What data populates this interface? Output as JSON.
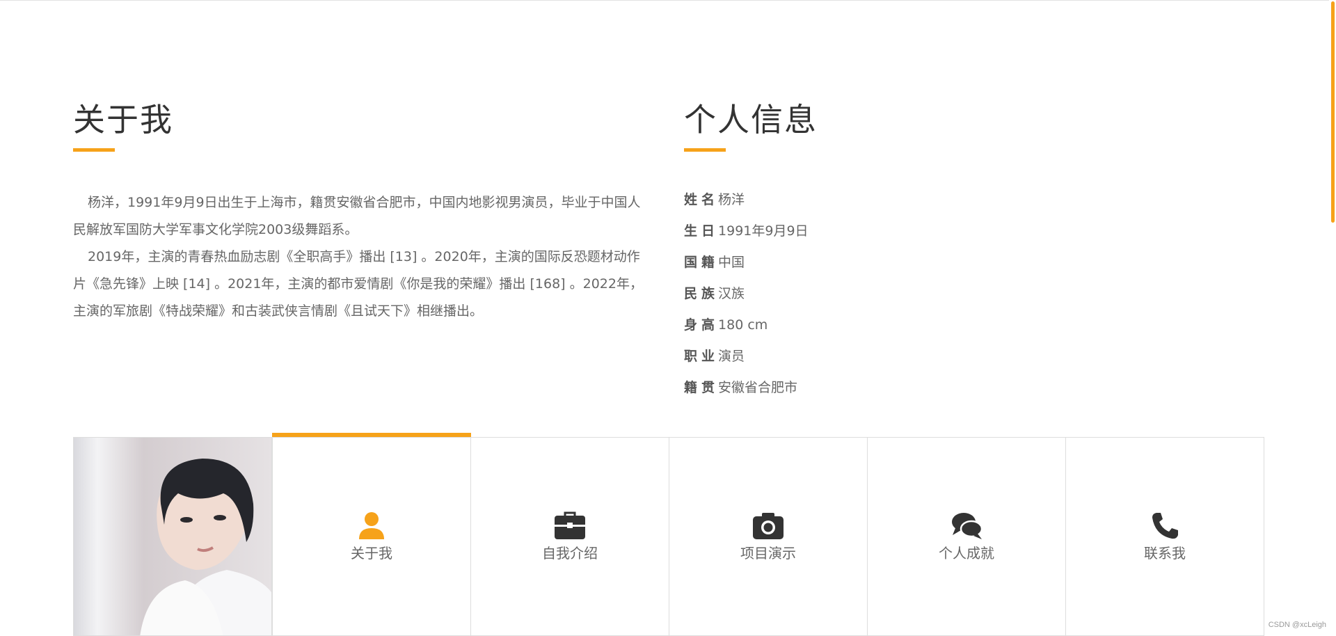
{
  "about": {
    "title": "关于我",
    "paragraphs": [
      "杨洋，1991年9月9日出生于上海市，籍贯安徽省合肥市，中国内地影视男演员，毕业于中国人民解放军国防大学军事文化学院2003级舞蹈系。",
      "2019年，主演的青春热血励志剧《全职高手》播出 [13] 。2020年，主演的国际反恐题材动作片《急先锋》上映 [14] 。2021年，主演的都市爱情剧《你是我的荣耀》播出 [168] 。2022年，主演的军旅剧《特战荣耀》和古装武侠言情剧《且试天下》相继播出。"
    ]
  },
  "info": {
    "title": "个人信息",
    "rows": [
      {
        "label": "姓名",
        "value": "杨洋"
      },
      {
        "label": "生日",
        "value": "1991年9月9日"
      },
      {
        "label": "国籍",
        "value": "中国"
      },
      {
        "label": "民族",
        "value": "汉族"
      },
      {
        "label": "身高",
        "value": "180 cm"
      },
      {
        "label": "职业",
        "value": "演员"
      },
      {
        "label": "籍贯",
        "value": "安徽省合肥市"
      }
    ]
  },
  "tiles": [
    {
      "label": "关于我",
      "icon": "user-icon",
      "active": true
    },
    {
      "label": "自我介绍",
      "icon": "briefcase-icon",
      "active": false
    },
    {
      "label": "项目演示",
      "icon": "camera-icon",
      "active": false
    },
    {
      "label": "个人成就",
      "icon": "comments-icon",
      "active": false
    },
    {
      "label": "联系我",
      "icon": "phone-icon",
      "active": false
    }
  ],
  "colors": {
    "accent": "#f6a21a",
    "icon": "#333333"
  },
  "footer": {
    "credit": "CSDN @xcLeigh"
  }
}
